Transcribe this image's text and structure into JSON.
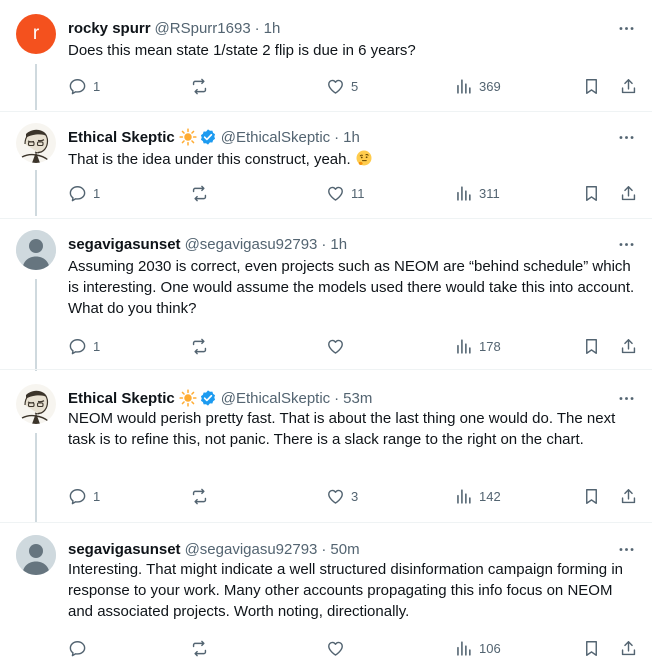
{
  "tweets": [
    {
      "avatar_letter": "r",
      "name": "rocky spurr",
      "handle": "@RSpurr1693",
      "time": "1h",
      "text": "Does this mean state 1/state 2 flip is due in 6 years?",
      "stats": {
        "replies": "1",
        "retweets": "",
        "likes": "5",
        "views": "369"
      }
    },
    {
      "name": "Ethical Skeptic",
      "handle": "@EthicalSkeptic",
      "time": "1h",
      "text": "That is the idea under this construct, yeah.",
      "stats": {
        "replies": "1",
        "retweets": "",
        "likes": "11",
        "views": "311"
      }
    },
    {
      "name": "segavigasunset",
      "handle": "@segavigasu92793",
      "time": "1h",
      "text": "Assuming 2030 is correct, even projects such as NEOM are “behind schedule” which is interesting. One would assume the models used there would take this into account. What do you think?",
      "stats": {
        "replies": "1",
        "retweets": "",
        "likes": "",
        "views": "178"
      }
    },
    {
      "name": "Ethical Skeptic",
      "handle": "@EthicalSkeptic",
      "time": "53m",
      "text": "NEOM would perish pretty fast. That is about the last thing one would do. The next task is to refine this, not panic. There is a slack range to the right on the chart.",
      "stats": {
        "replies": "1",
        "retweets": "",
        "likes": "3",
        "views": "142"
      }
    },
    {
      "name": "segavigasunset",
      "handle": "@segavigasu92793",
      "time": "50m",
      "text": "Interesting. That might indicate a well structured disinformation campaign forming in response to your work. Many other accounts propagating this info focus on NEOM and associated projects. Worth noting, directionally.",
      "stats": {
        "replies": "",
        "retweets": "",
        "likes": "",
        "views": "106"
      }
    }
  ],
  "colors": {
    "text": "#0f1419",
    "secondary": "#536471",
    "verified": "#1d9bf0",
    "sun": "#ffac33",
    "divider": "#eff3f4",
    "thread": "#cfd9de",
    "avatar_r": "#f4511e"
  },
  "icons": [
    "more-icon",
    "reply-icon",
    "retweet-icon",
    "like-icon",
    "views-icon",
    "bookmark-icon",
    "share-icon",
    "verified-badge-icon",
    "sun-emoji-icon",
    "thinking-emoji-icon"
  ]
}
